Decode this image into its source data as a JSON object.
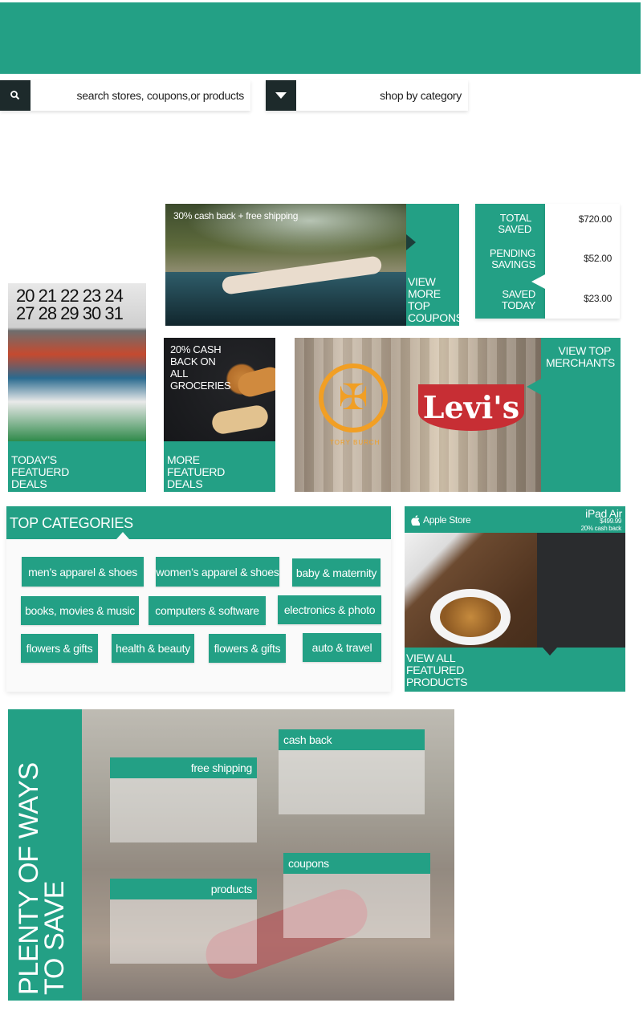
{
  "search": {
    "placeholder": "search stores, coupons,or products"
  },
  "category": {
    "label": "shop by category"
  },
  "hero": {
    "caption": "30% cash back + free shipping",
    "link": "VIEW MORE TOP COUPONS"
  },
  "savings": [
    {
      "label": "TOTAL SAVED",
      "value": "$720.00"
    },
    {
      "label": "PENDING SAVINGS",
      "value": "$52.00"
    },
    {
      "label": "SAVED TODAY",
      "value": "$23.00"
    }
  ],
  "today_deals": {
    "calendar": "20 21 22 23 24\n27 28 29 30 31",
    "label": "TODAY'S FEATUERD DEALS"
  },
  "groceries": {
    "caption": "20% CASH BACK ON ALL GROCERIES",
    "label": "MORE FEATUERD DEALS"
  },
  "merchants": {
    "link": "VIEW TOP MERCHANTS",
    "tory_text": "TORY BURCH",
    "levis_text": "Levi's"
  },
  "top_categories": {
    "title": "TOP CATEGORIES",
    "items": [
      "men’s apparel & shoes",
      "women’s apparel & shoes",
      "baby & maternity",
      "books, movies & music",
      "computers & software",
      "electronics & photo",
      "flowers & gifts",
      "health & beauty",
      "flowers & gifts",
      "auto & travel"
    ]
  },
  "apple": {
    "store": "Apple Store",
    "product": "iPad Air",
    "price": "$499.99",
    "cashback": "20% cash back",
    "link": "VIEW ALL FEATURED PRODUCTS"
  },
  "ways": {
    "title_line1": "PLENTY OF WAYS",
    "title_line2": "TO SAVE",
    "cards": [
      "cash back",
      "free shipping",
      "coupons",
      "products"
    ]
  },
  "colors": {
    "accent": "#23a085",
    "dark": "#1d2a2b"
  },
  "icons": {
    "search": "search-icon",
    "dropdown": "chevron-down-icon",
    "apple": "apple-logo-icon"
  }
}
